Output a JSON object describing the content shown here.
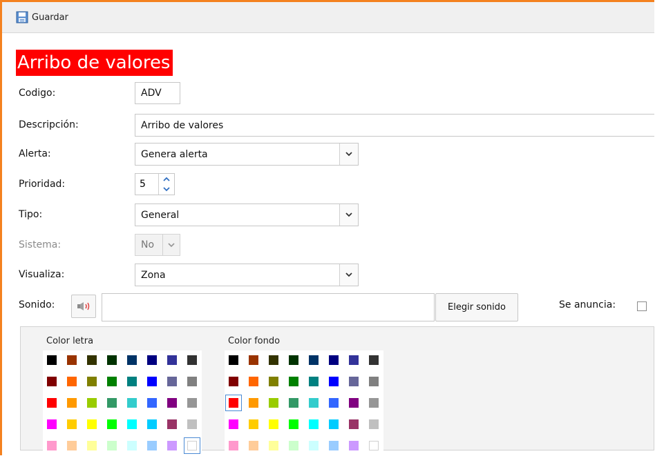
{
  "toolbar": {
    "save_label": "Guardar"
  },
  "form": {
    "title": "Arribo de valores",
    "codigo": {
      "label": "Codigo:",
      "value": "ADV"
    },
    "descripcion": {
      "label": "Descripción:",
      "value": "Arribo de valores"
    },
    "alerta": {
      "label": "Alerta:",
      "value": "Genera alerta"
    },
    "prioridad": {
      "label": "Prioridad:",
      "value": "5"
    },
    "tipo": {
      "label": "Tipo:",
      "value": "General"
    },
    "sistema": {
      "label": "Sistema:",
      "value": "No"
    },
    "visualiza": {
      "label": "Visualiza:",
      "value": "Zona"
    },
    "sonido": {
      "label": "Sonido:",
      "value": "",
      "choose_button": "Elegir sonido"
    },
    "se_anuncia": {
      "label": "Se anuncia:",
      "checked": false
    }
  },
  "colors": {
    "letra": {
      "title": "Color letra",
      "selected": "#ffffff"
    },
    "fondo": {
      "title": "Color fondo",
      "selected": "#ff0000"
    },
    "palette": [
      [
        "#000000",
        "#993300",
        "#333300",
        "#003300",
        "#003366",
        "#000080",
        "#333399",
        "#333333"
      ],
      [
        "#800000",
        "#ff6600",
        "#808000",
        "#008000",
        "#008080",
        "#0000ff",
        "#666699",
        "#808080"
      ],
      [
        "#ff0000",
        "#ff9900",
        "#99cc00",
        "#339966",
        "#33cccc",
        "#3366ff",
        "#800080",
        "#969696"
      ],
      [
        "#ff00ff",
        "#ffcc00",
        "#ffff00",
        "#00ff00",
        "#00ffff",
        "#00ccff",
        "#993366",
        "#c0c0c0"
      ],
      [
        "#ff99cc",
        "#ffcc99",
        "#ffff99",
        "#ccffcc",
        "#ccffff",
        "#99ccff",
        "#cc99ff",
        "#ffffff"
      ]
    ]
  }
}
